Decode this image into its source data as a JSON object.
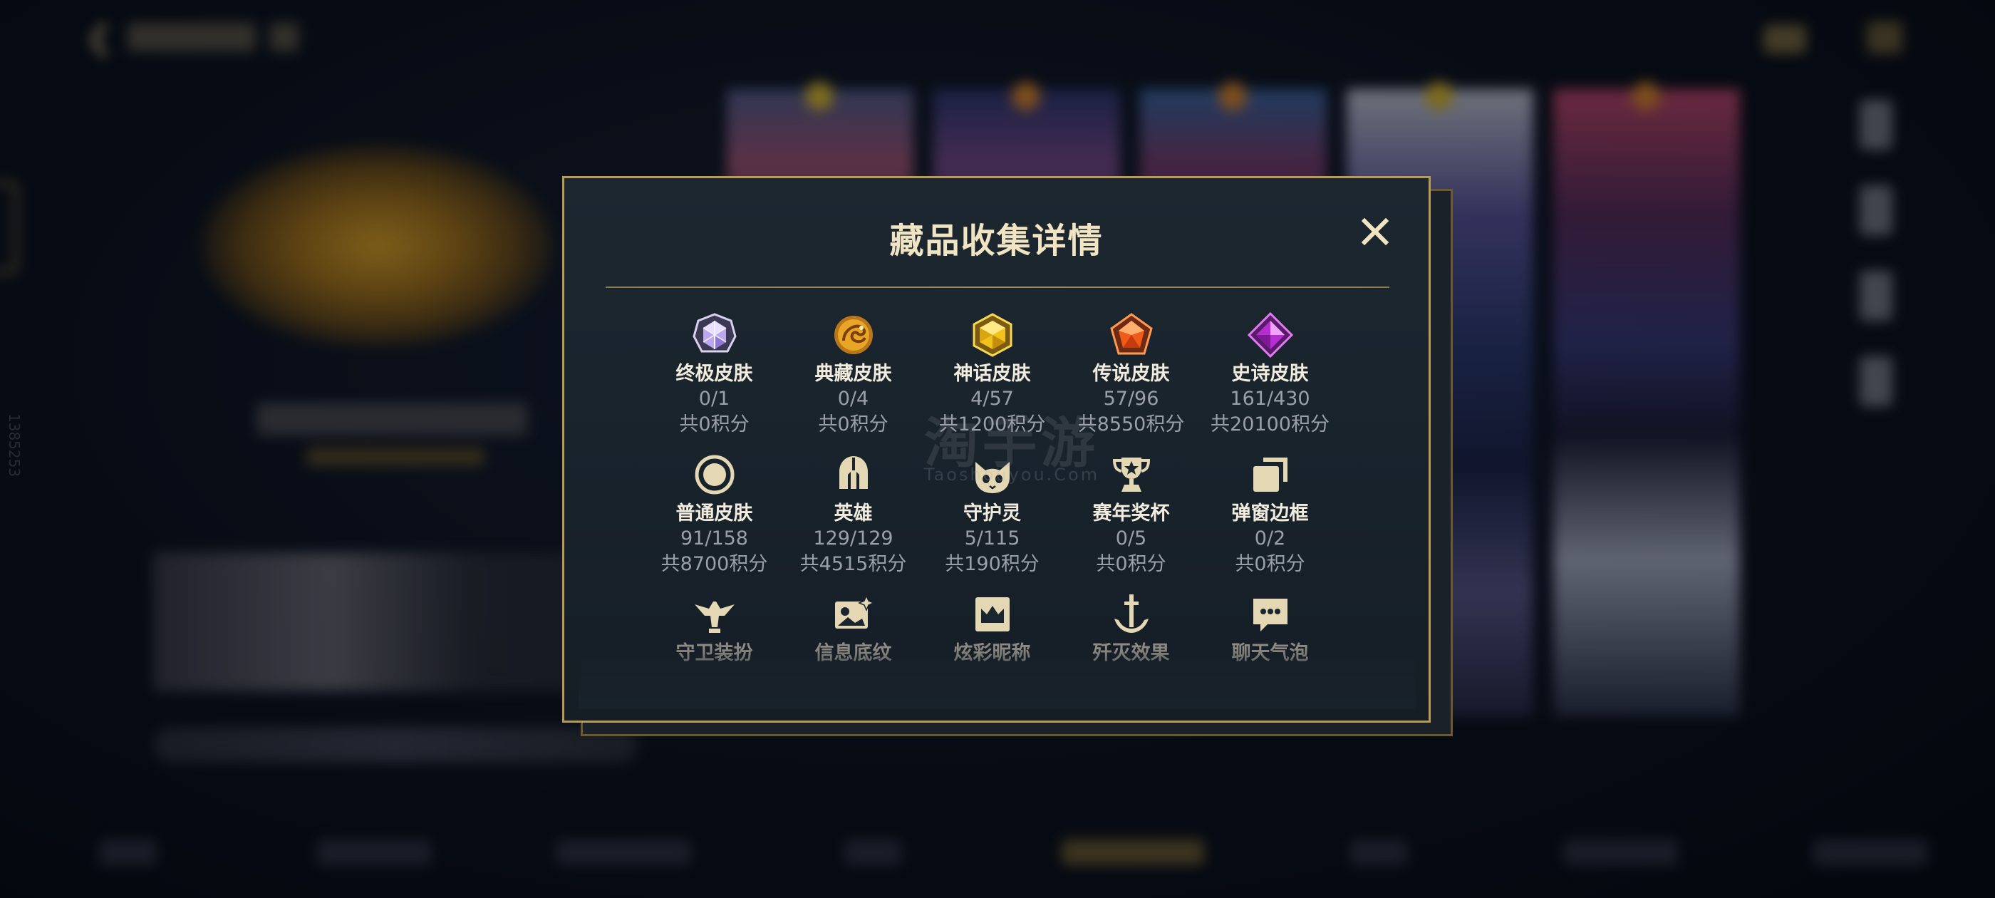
{
  "modal": {
    "title": "藏品收集详情",
    "close_glyph": "✕"
  },
  "collections": [
    {
      "name": "终极皮肤",
      "count": "0/1",
      "points": "共0积分",
      "icon": "diamond-gem-icon",
      "color": "#c9b7f0"
    },
    {
      "name": "典藏皮肤",
      "count": "0/4",
      "points": "共0积分",
      "icon": "dragon-emblem-icon",
      "color": "#e7a52a"
    },
    {
      "name": "神话皮肤",
      "count": "4/57",
      "points": "共1200积分",
      "icon": "gold-gem-icon",
      "color": "#f0c21e"
    },
    {
      "name": "传说皮肤",
      "count": "57/96",
      "points": "共8550积分",
      "icon": "orange-pentagon-gem-icon",
      "color": "#f06a1e"
    },
    {
      "name": "史诗皮肤",
      "count": "161/430",
      "points": "共20100积分",
      "icon": "purple-diamond-gem-icon",
      "color": "#c03ad8"
    },
    {
      "name": "普通皮肤",
      "count": "91/158",
      "points": "共8700积分",
      "icon": "ring-icon",
      "color": "#d9ccaa"
    },
    {
      "name": "英雄",
      "count": "129/129",
      "points": "共4515积分",
      "icon": "helmet-icon",
      "color": "#d9ccaa"
    },
    {
      "name": "守护灵",
      "count": "5/115",
      "points": "共190积分",
      "icon": "spirit-cat-icon",
      "color": "#d9ccaa"
    },
    {
      "name": "赛年奖杯",
      "count": "0/5",
      "points": "共0积分",
      "icon": "trophy-icon",
      "color": "#d9ccaa"
    },
    {
      "name": "弹窗边框",
      "count": "0/2",
      "points": "共0积分",
      "icon": "stacked-frames-icon",
      "color": "#d9ccaa"
    },
    {
      "name": "守卫装扮",
      "icon": "guard-bird-icon",
      "color": "#d9ccaa"
    },
    {
      "name": "信息底纹",
      "icon": "picture-sparkle-icon",
      "color": "#d9ccaa"
    },
    {
      "name": "炫彩昵称",
      "icon": "crown-card-icon",
      "color": "#d9ccaa"
    },
    {
      "name": "歼灭效果",
      "icon": "anchor-sword-icon",
      "color": "#d9ccaa"
    },
    {
      "name": "聊天气泡",
      "icon": "chat-bubble-icon",
      "color": "#d9ccaa"
    }
  ],
  "watermark": {
    "main": "淘手游",
    "sub": "Taoshouyou.Com"
  },
  "side_number": "1385253",
  "colors": {
    "gold_border": "#b89a52",
    "title": "#f1e4c2",
    "muted": "#9aa0ab",
    "panel": "#1b252e"
  }
}
